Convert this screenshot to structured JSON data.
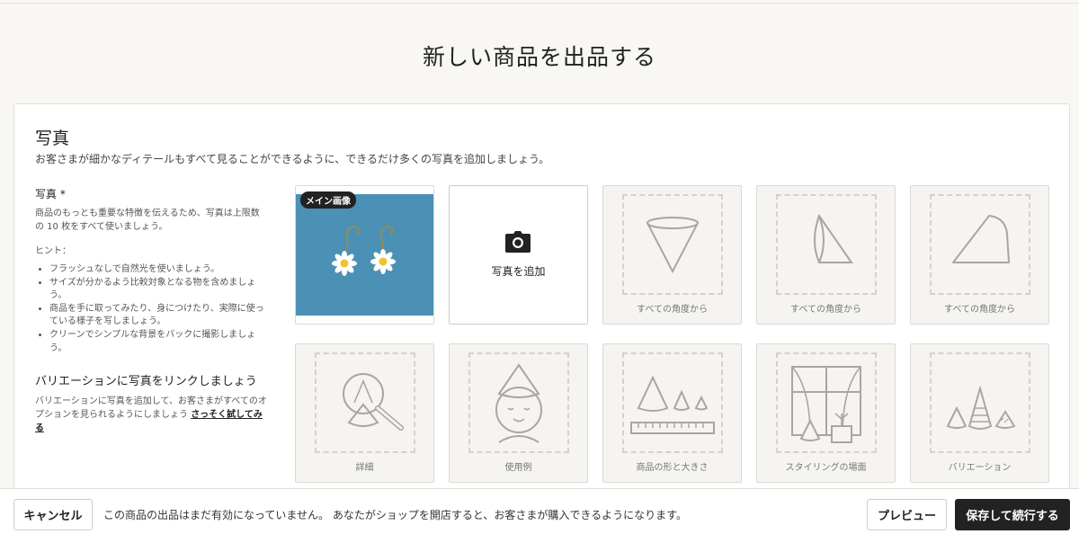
{
  "page": {
    "title": "新しい商品を出品する"
  },
  "photos": {
    "section_title": "写真",
    "section_desc": "お客さまが細かなディテールもすべて見ることができるように、できるだけ多くの写真を追加しましょう。",
    "side": {
      "label": "写真 *",
      "text": "商品のもっとも重要な特徴を伝えるため、写真は上限数の 10 枚をすべて使いましょう。",
      "hint_title": "ヒント：",
      "hints": [
        "フラッシュなしで自然光を使いましょう。",
        "サイズが分かるよう比較対象となる物を含めましょう。",
        "商品を手に取ってみたり、身につけたり、実際に使っている様子を写しましょう。",
        "クリーンでシンプルな背景をバックに撮影しましょう。"
      ],
      "variation_title": "バリエーションに写真をリンクしましょう",
      "variation_text": "バリエーションに写真を追加して、お客さまがすべてのオプションを見られるようにしましょう",
      "variation_link": "さっそく試してみる"
    },
    "main_badge": "メイン画像",
    "add_label": "写真を追加",
    "placeholders": [
      {
        "caption": "すべての角度から",
        "icon": "cone-front-icon"
      },
      {
        "caption": "すべての角度から",
        "icon": "cone-side-icon"
      },
      {
        "caption": "すべての角度から",
        "icon": "cone-tilt-icon"
      },
      {
        "caption": "詳細",
        "icon": "magnifier-detail-icon"
      },
      {
        "caption": "使用例",
        "icon": "cone-hat-person-icon"
      },
      {
        "caption": "商品の形と大きさ",
        "icon": "cone-ruler-icon"
      },
      {
        "caption": "スタイリングの場面",
        "icon": "window-plant-icon"
      },
      {
        "caption": "バリエーション",
        "icon": "cone-variations-icon"
      }
    ]
  },
  "footer": {
    "cancel_label": "キャンセル",
    "message": "この商品の出品はまだ有効になっていません。 あなたがショップを開店すると、お客さまが購入できるようになります。",
    "preview_label": "プレビュー",
    "save_label": "保存して続行する"
  },
  "colors": {
    "background": "#f8f7f4",
    "primary_button": "#222222",
    "photo_bg": "#4f95b8"
  }
}
